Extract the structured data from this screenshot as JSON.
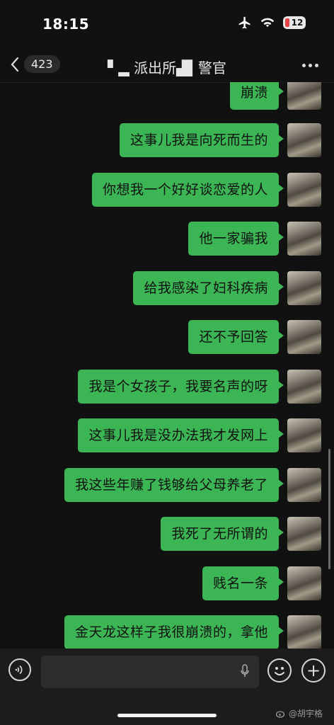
{
  "status_bar": {
    "time": "18:15",
    "battery": "12"
  },
  "nav": {
    "back_count": "423",
    "title": "▘▂ 派出所▟▌警官"
  },
  "messages": [
    {
      "text": "崩溃"
    },
    {
      "text": "这事儿我是向死而生的"
    },
    {
      "text": "你想我一个好好谈恋爱的人"
    },
    {
      "text": "他一家骗我"
    },
    {
      "text": "给我感染了妇科疾病"
    },
    {
      "text": "还不予回答"
    },
    {
      "text": "我是个女孩子，我要名声的呀"
    },
    {
      "text": "这事儿我是没办法我才发网上"
    },
    {
      "text": "我这些年赚了钱够给父母养老了"
    },
    {
      "text": "我死了无所谓的"
    },
    {
      "text": "贱名一条"
    },
    {
      "text": "金天龙这样子我很崩溃的，拿他"
    }
  ],
  "watermark": "@胡宇格",
  "colors": {
    "bubble": "#3cb554",
    "background": "#111111",
    "input_bar": "#1c1c1c"
  }
}
